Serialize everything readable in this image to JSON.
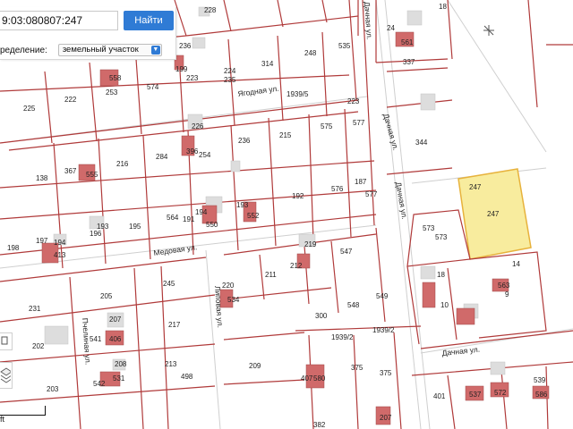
{
  "search": {
    "value": "9:03:080807:247",
    "button_label": "Найти"
  },
  "purpose": {
    "label": "ределение:",
    "selected": "земельный участок"
  },
  "selected_parcel": {
    "label": "247",
    "fill": "#f8ec9e",
    "stroke": "#e7b23c"
  },
  "colors": {
    "boundary": "#b03a3a",
    "building": "#d06a6a",
    "building_gray": "#dddddd",
    "accent": "#2f7bd5"
  },
  "streets": {
    "yagodnaya": "Ягодная ул.",
    "medovaya": "Медовая ул.",
    "lipovaya": "Липовая ул.",
    "dachnaya_top": "Дачная ул.",
    "dachnaya_mid": "Дачная ул.",
    "dachnaya_low": "Дачная ул.",
    "dachnaya_bottom": "Дачная ул.",
    "pchelinaya": "Пчелиная ул."
  },
  "parcels": [
    "228",
    "236",
    "314",
    "248",
    "535",
    "24",
    "561",
    "337",
    "1939/5",
    "235",
    "224",
    "223",
    "199",
    "558",
    "253",
    "574",
    "225",
    "222",
    "18",
    "223",
    "577",
    "226",
    "236",
    "215",
    "575",
    "344",
    "396",
    "254",
    "367",
    "555",
    "216",
    "284",
    "138",
    "193",
    "552",
    "192",
    "576",
    "187",
    "577",
    "194",
    "550",
    "564",
    "191",
    "193",
    "195",
    "196",
    "219",
    "573",
    "247",
    "197",
    "194",
    "413",
    "198",
    "547",
    "211",
    "212",
    "14",
    "18",
    "563",
    "9",
    "573",
    "10",
    "220",
    "534",
    "205",
    "245",
    "231",
    "207",
    "406",
    "217",
    "541",
    "300",
    "1939/2",
    "1939/2",
    "548",
    "549",
    "202",
    "208",
    "213",
    "498",
    "209",
    "375",
    "542",
    "531",
    "407",
    "580",
    "375",
    "203",
    "401",
    "537",
    "572",
    "539",
    "586",
    "382",
    "207"
  ],
  "scale": {
    "unit": "ft"
  }
}
